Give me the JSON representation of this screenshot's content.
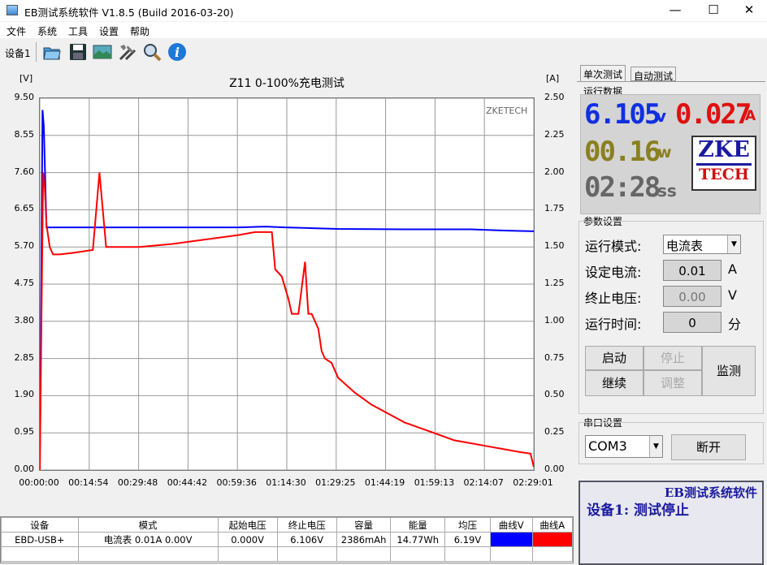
{
  "window": {
    "title": "EB测试系统软件 V1.8.5 (Build 2016-03-20)",
    "minimize": "—",
    "maximize": "☐",
    "close": "✕"
  },
  "menu": [
    "文件",
    "系统",
    "工具",
    "设置",
    "帮助"
  ],
  "toolbar": {
    "device_tab": "设备1"
  },
  "chart_data": {
    "type": "line",
    "title": "Z11 0-100%充电测试",
    "watermark": "ZKETECH",
    "ylabel_left": "[V]",
    "ylabel_right": "[A]",
    "y_left_ticks": [
      "9.50",
      "8.55",
      "7.60",
      "6.65",
      "5.70",
      "4.75",
      "3.80",
      "2.85",
      "1.90",
      "0.95",
      "0.00"
    ],
    "y_right_ticks": [
      "2.50",
      "2.25",
      "2.00",
      "1.75",
      "1.50",
      "1.25",
      "1.00",
      "0.75",
      "0.50",
      "0.25",
      "0.00"
    ],
    "x_ticks": [
      "00:00:00",
      "00:14:54",
      "00:29:48",
      "00:44:42",
      "00:59:36",
      "01:14:30",
      "01:29:25",
      "01:44:19",
      "01:59:13",
      "02:14:07",
      "02:29:01"
    ],
    "ylim_left": [
      0,
      9.5
    ],
    "ylim_right": [
      0,
      2.5
    ],
    "xlim_minutes": [
      0,
      149
    ],
    "series": [
      {
        "axis": "left",
        "color": "#0000ff",
        "x": [
          0,
          0.5,
          0.8,
          1.2,
          2,
          10,
          40,
          60,
          68,
          74,
          90,
          110,
          130,
          140,
          149
        ],
        "y": [
          0.0,
          5.2,
          9.2,
          8.8,
          6.2,
          6.2,
          6.2,
          6.2,
          6.22,
          6.2,
          6.16,
          6.15,
          6.15,
          6.12,
          6.1
        ]
      },
      {
        "axis": "right",
        "color": "#ff0000",
        "x": [
          0,
          0.5,
          1,
          1.5,
          2,
          3,
          4,
          6,
          10,
          16,
          18,
          20,
          30,
          40,
          50,
          60,
          65,
          70,
          71,
          73,
          75,
          76,
          78,
          80,
          81,
          82,
          84,
          85,
          86,
          88,
          90,
          93,
          95,
          100,
          105,
          110,
          115,
          120,
          125,
          130,
          135,
          140,
          145,
          148,
          149
        ],
        "y": [
          0.0,
          1.0,
          2.0,
          1.9,
          1.65,
          1.5,
          1.45,
          1.45,
          1.46,
          1.48,
          2.0,
          1.5,
          1.5,
          1.52,
          1.55,
          1.58,
          1.6,
          1.6,
          1.35,
          1.3,
          1.15,
          1.05,
          1.05,
          1.4,
          1.05,
          1.05,
          0.95,
          0.8,
          0.75,
          0.72,
          0.62,
          0.56,
          0.52,
          0.44,
          0.38,
          0.32,
          0.28,
          0.24,
          0.2,
          0.18,
          0.16,
          0.14,
          0.12,
          0.11,
          0.02
        ]
      }
    ]
  },
  "table": {
    "headers": [
      "设备",
      "模式",
      "起始电压",
      "终止电压",
      "容量",
      "能量",
      "均压",
      "曲线V",
      "曲线A"
    ],
    "row": [
      "EBD-USB+",
      "电流表  0.01A  0.00V",
      "0.000V",
      "6.106V",
      "2386mAh",
      "14.77Wh",
      "6.19V",
      "",
      ""
    ],
    "curve_v_color": "#0000ff",
    "curve_a_color": "#ff0000"
  },
  "right": {
    "tabs": [
      "单次测试",
      "自动测试"
    ],
    "run_data_label": "运行数据",
    "voltage": "6.105",
    "voltage_unit": "v",
    "current": "0.027",
    "current_unit": "A",
    "power": "00.16",
    "power_unit": "w",
    "time": "02:28",
    "time_unit": "ss",
    "logo_top": "ZKE",
    "logo_bottom": "TECH",
    "params_label": "参数设置",
    "mode_label": "运行模式:",
    "mode_value": "电流表",
    "set_current_label": "设定电流:",
    "set_current_value": "0.01",
    "set_current_unit": "A",
    "cutoff_label": "终止电压:",
    "cutoff_value": "0.00",
    "cutoff_unit": "V",
    "runtime_label": "运行时间:",
    "runtime_value": "0",
    "runtime_unit": "分",
    "btn_start": "启动",
    "btn_stop": "停止",
    "btn_continue": "继续",
    "btn_adjust": "调整",
    "btn_monitor": "监测",
    "serial_label": "串口设置",
    "com_value": "COM3",
    "btn_disconnect": "断开",
    "status_title": "EB测试系统软件",
    "status_text": "设备1: 测试停止"
  }
}
